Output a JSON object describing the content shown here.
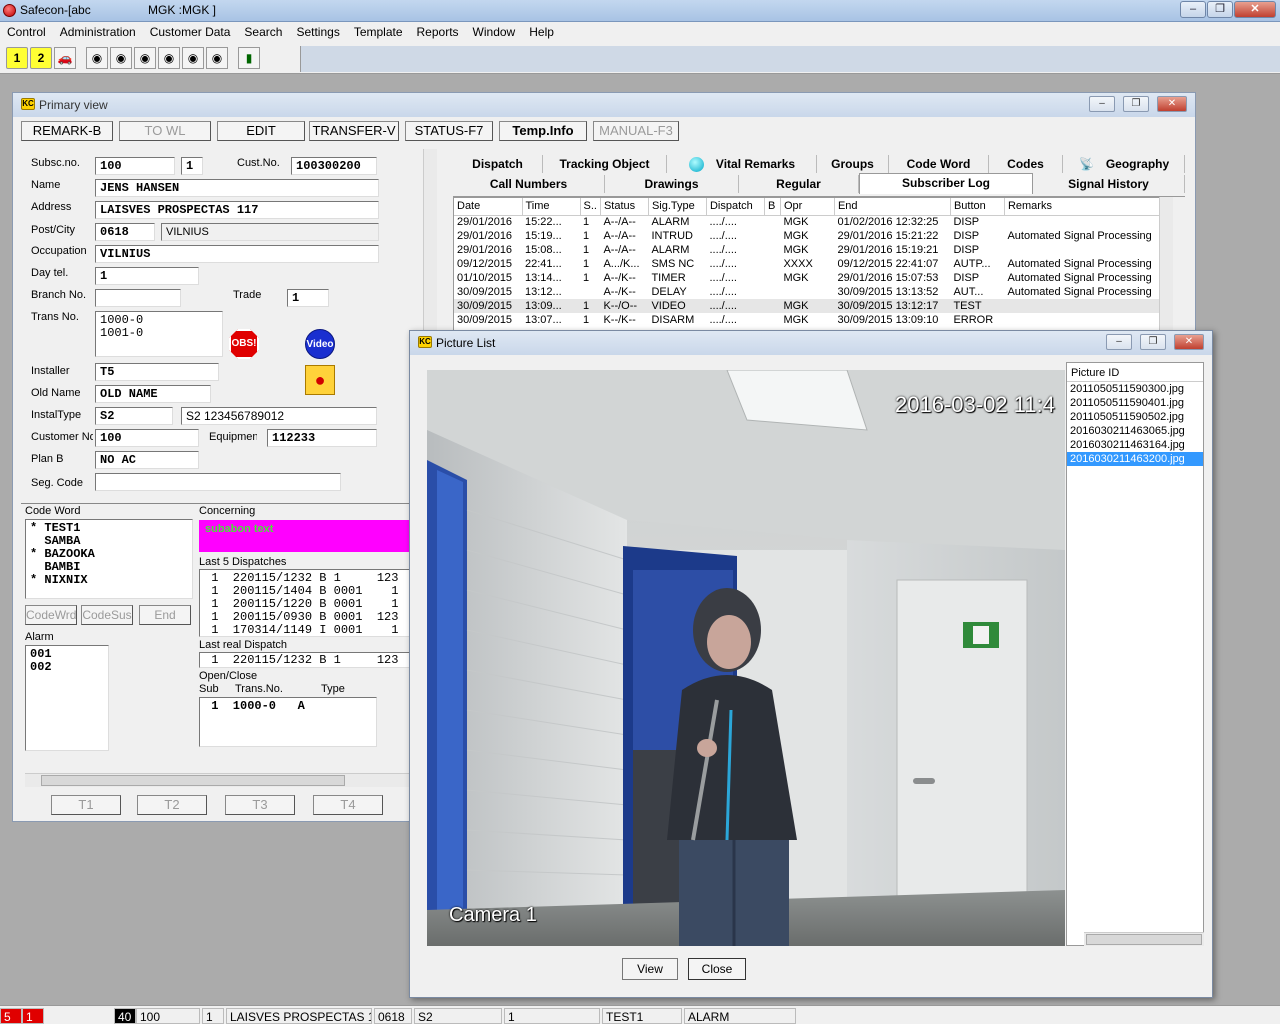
{
  "app": {
    "title": "Safecon-[abc",
    "title_user": "MGK  :MGK  ]"
  },
  "menu": [
    "Control",
    "Administration",
    "Customer Data",
    "Search",
    "Settings",
    "Template",
    "Reports",
    "Window",
    "Help"
  ],
  "toolbar": {
    "btn1": "1",
    "btn2": "2"
  },
  "primary": {
    "title": "Primary view",
    "actions": [
      {
        "label": "REMARK-B",
        "disabled": false
      },
      {
        "label": "TO WL",
        "disabled": true
      },
      {
        "label": "EDIT",
        "disabled": false
      },
      {
        "label": "TRANSFER-V",
        "disabled": false
      },
      {
        "label": "STATUS-F7",
        "disabled": false
      },
      {
        "label": "Temp.Info",
        "disabled": false
      },
      {
        "label": "MANUAL-F3",
        "disabled": true
      }
    ],
    "labels": {
      "subsc": "Subsc.no.",
      "cust": "Cust.No.",
      "name": "Name",
      "address": "Address",
      "postcity": "Post/City",
      "occupation": "Occupation",
      "daytel": "Day tel.",
      "branch": "Branch No.",
      "trade": "Trade",
      "trans": "Trans No.",
      "installer": "Installer",
      "oldname": "Old Name",
      "instaltype": "InstalType",
      "customerno": "Customer No",
      "equipment": "Equipment",
      "planb": "Plan B",
      "segcode": "Seg. Code"
    },
    "values": {
      "subsc": "100",
      "subsc2": "1",
      "cust": "100300200",
      "name": "JENS HANSEN",
      "address": "LAISVES PROSPECTAS 117",
      "post": "0618",
      "city": "VILNIUS",
      "occupation": "VILNIUS",
      "daytel": "1",
      "branch": "",
      "trade": "1",
      "trans": "1000-0\n1001-0",
      "installer": "T5",
      "oldname": "OLD NAME",
      "instaltype": "S2",
      "instaltype_desc": "S2 123456789012",
      "customerno": "100",
      "equipment": "112233",
      "planb": "NO AC",
      "segcode": ""
    },
    "badges": {
      "obs": "OBS!",
      "video": "Video"
    },
    "codeword": {
      "label": "Code Word",
      "text": "* TEST1\n  SAMBA\n* BAZOOKA\n  BAMBI\n* NIXNIX"
    },
    "codeword_btns": [
      "CodeWrd",
      "CodeSus",
      "End"
    ],
    "alarm": {
      "label": "Alarm",
      "text": "001\n002"
    },
    "concerning": {
      "label": "Concerning",
      "text": "subabon text"
    },
    "last5": {
      "label": "Last 5 Dispatches",
      "text": " 1  220115/1232 B 1     123\n 1  200115/1404 B 0001    1\n 1  200115/1220 B 0001    1\n 1  200115/0930 B 0001  123\n 1  170314/1149 I 0001    1"
    },
    "lastreal": {
      "label": "Last real Dispatch",
      "text": " 1  220115/1232 B 1     123"
    },
    "openclose": {
      "label": "Open/Close",
      "sub": "Sub",
      "transno": "Trans.No.",
      "type": "Type",
      "text": " 1  1000-0   A"
    },
    "bottom_tabs": [
      "T1",
      "T2",
      "T3",
      "T4"
    ],
    "tabs_row1": [
      "Dispatch",
      "Tracking Object",
      "Vital Remarks",
      "Groups",
      "Code Word",
      "Codes",
      "Geography"
    ],
    "tabs_row2": [
      "Call Numbers",
      "Drawings",
      "Regular",
      "Subscriber Log",
      "Signal History"
    ],
    "log": {
      "headers": [
        "Date",
        "Time",
        "S..",
        "Status",
        "Sig.Type",
        "Dispatch",
        "B",
        "Opr",
        "End",
        "Button",
        "Remarks"
      ],
      "rows": [
        [
          "29/01/2016",
          "15:22...",
          "1",
          "A--/A--",
          "ALARM",
          "..../....",
          "",
          "MGK",
          "01/02/2016 12:32:25",
          "DISP",
          ""
        ],
        [
          "29/01/2016",
          "15:19...",
          "1",
          "A--/A--",
          "INTRUD",
          "..../....",
          "",
          "MGK",
          "29/01/2016 15:21:22",
          "DISP",
          "Automated Signal Processing"
        ],
        [
          "29/01/2016",
          "15:08...",
          "1",
          "A--/A--",
          "ALARM",
          "..../....",
          "",
          "MGK",
          "29/01/2016 15:19:21",
          "DISP",
          ""
        ],
        [
          "09/12/2015",
          "22:41...",
          "1",
          "A.../K...",
          "SMS NC",
          "..../....",
          "",
          "XXXX",
          "09/12/2015 22:41:07",
          "AUTP...",
          "Automated Signal Processing"
        ],
        [
          "01/10/2015",
          "13:14...",
          "1",
          "A--/K--",
          "TIMER",
          "..../....",
          "",
          "MGK",
          "29/01/2016 15:07:53",
          "DISP",
          "Automated Signal Processing"
        ],
        [
          "30/09/2015",
          "13:12...",
          "",
          "A--/K--",
          "DELAY",
          "..../....",
          "",
          "",
          "30/09/2015 13:13:52",
          "AUT...",
          "Automated Signal Processing"
        ],
        [
          "30/09/2015",
          "13:09...",
          "1",
          "K--/O--",
          "VIDEO",
          "..../....",
          "",
          "MGK",
          "30/09/2015 13:12:17",
          "TEST",
          ""
        ],
        [
          "30/09/2015",
          "13:07...",
          "1",
          "K--/K--",
          "DISARM",
          "..../....",
          "",
          "MGK",
          "30/09/2015 13:09:10",
          "ERROR",
          ""
        ]
      ]
    }
  },
  "picture_list": {
    "title": "Picture List",
    "timestamp": "2016-03-02 11:4",
    "camera": "Camera 1",
    "id_header": "Picture ID",
    "ids": [
      "2011050511590300.jpg",
      "2011050511590401.jpg",
      "2011050511590502.jpg",
      "2016030211463065.jpg",
      "2016030211463164.jpg",
      "2016030211463200.jpg"
    ],
    "selected_index": 5,
    "view_btn": "View",
    "close_btn": "Close"
  },
  "statusbar": [
    "5",
    "1",
    "40",
    "100",
    "1",
    "LAISVES PROSPECTAS 117",
    "0618",
    "S2",
    "1",
    "TEST1",
    "ALARM"
  ]
}
